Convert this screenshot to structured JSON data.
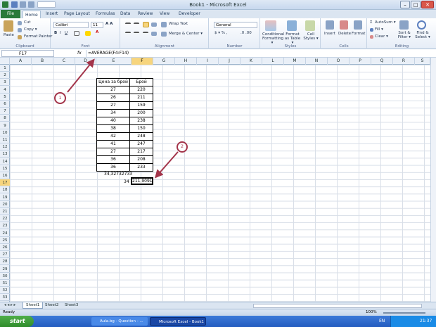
{
  "window": {
    "title": "Book1 - Microsoft Excel",
    "minimize": "–",
    "maximize": "□",
    "close": "✕"
  },
  "ribbon_tabs": [
    "File",
    "Home",
    "Insert",
    "Page Layout",
    "Formulas",
    "Data",
    "Review",
    "View",
    "Developer"
  ],
  "clipboard": {
    "paste": "Paste",
    "cut": "Cut",
    "copy": "Copy ▾",
    "format_painter": "Format Painter",
    "label": "Clipboard"
  },
  "font": {
    "name": "Calibri",
    "size": "11",
    "label": "Font"
  },
  "alignment": {
    "wrap_text": "Wrap Text",
    "merge_center": "Merge & Center ▾",
    "label": "Alignment"
  },
  "number": {
    "format": "General",
    "label": "Number"
  },
  "styles": {
    "conditional": "Conditional Formatting ▾",
    "format_table": "Format as Table ▾",
    "cell_styles": "Cell Styles ▾",
    "label": "Styles"
  },
  "cells": {
    "insert": "Insert",
    "delete": "Delete",
    "format": "Format",
    "label": "Cells"
  },
  "editing": {
    "autosum": "AutoSum ▾",
    "fill": "Fill ▾",
    "clear": "Clear ▾",
    "sort_filter": "Sort & Filter ▾",
    "find_select": "Find & Select ▾",
    "label": "Editing"
  },
  "formula_bar": {
    "name_box": "F17",
    "fx": "fx",
    "formula": "=AVERAGE(F4:F14)"
  },
  "columns": [
    "A",
    "B",
    "C",
    "D",
    "E",
    "F",
    "G",
    "H",
    "I",
    "J",
    "K",
    "L",
    "M",
    "N",
    "O",
    "P",
    "Q",
    "R",
    "S"
  ],
  "rows": [
    "1",
    "2",
    "3",
    "4",
    "5",
    "6",
    "7",
    "8",
    "9",
    "10",
    "11",
    "12",
    "13",
    "14",
    "15",
    "16",
    "17",
    "18",
    "19",
    "20",
    "21",
    "22",
    "23",
    "24",
    "25",
    "26",
    "27",
    "28",
    "29",
    "30",
    "31",
    "32",
    "33"
  ],
  "table": {
    "headers": [
      "Цена за брой",
      "Брой"
    ],
    "rows": [
      [
        "27",
        "220"
      ],
      [
        "26",
        "211"
      ],
      [
        "27",
        "159"
      ],
      [
        "34",
        "200"
      ],
      [
        "40",
        "238"
      ],
      [
        "38",
        "150"
      ],
      [
        "42",
        "248"
      ],
      [
        "41",
        "247"
      ],
      [
        "27",
        "217"
      ],
      [
        "36",
        "208"
      ],
      [
        "36",
        "233"
      ]
    ]
  },
  "cells_extra": {
    "e16": "34,32732733",
    "e17": "34",
    "f17": "211,9091"
  },
  "callouts": {
    "one": "1",
    "two": "2"
  },
  "sheets": [
    "Sheet1",
    "Sheet2",
    "Sheet3"
  ],
  "status": {
    "ready": "Ready",
    "zoom": "100%"
  },
  "taskbar": {
    "start": "start",
    "task1": "Aula.bg - Question - ...",
    "task2": "Microsoft Excel - Book1",
    "lang": "EN",
    "time": "21:37"
  }
}
